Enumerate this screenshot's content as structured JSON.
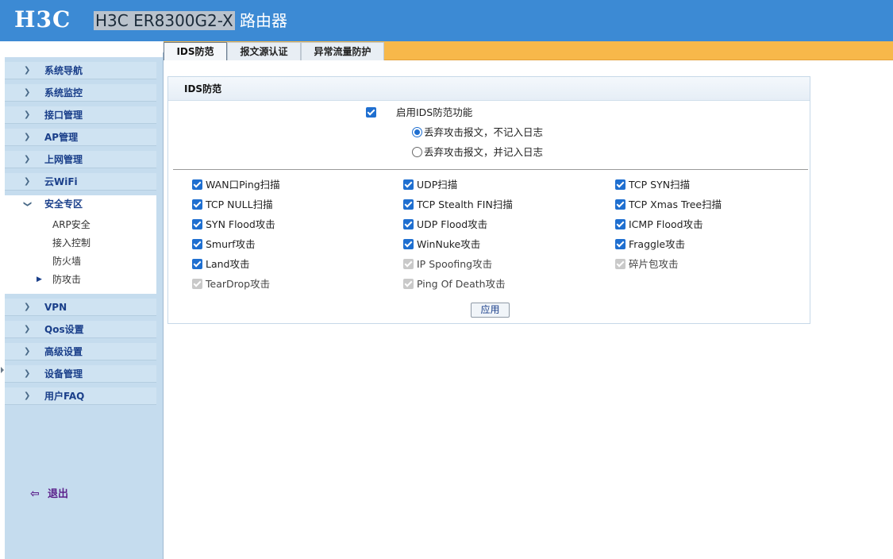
{
  "header": {
    "logo": "H3C",
    "model": "H3C ER8300G2-X",
    "product_suffix": " 路由器"
  },
  "tabs": [
    {
      "label": "IDS防范",
      "active": true
    },
    {
      "label": "报文源认证",
      "active": false
    },
    {
      "label": "异常流量防护",
      "active": false
    }
  ],
  "sidebar": {
    "items": [
      {
        "label": "系统导航"
      },
      {
        "label": "系统监控"
      },
      {
        "label": "接口管理"
      },
      {
        "label": "AP管理"
      },
      {
        "label": "上网管理"
      },
      {
        "label": "云WiFi"
      },
      {
        "label": "安全专区",
        "open": true,
        "children": [
          {
            "label": "ARP安全"
          },
          {
            "label": "接入控制"
          },
          {
            "label": "防火墙"
          },
          {
            "label": "防攻击",
            "current": true
          }
        ]
      },
      {
        "label": "VPN"
      },
      {
        "label": "Qos设置"
      },
      {
        "label": "高级设置"
      },
      {
        "label": "设备管理"
      },
      {
        "label": "用户FAQ"
      }
    ],
    "logout_label": "退出"
  },
  "panel": {
    "title": "IDS防范",
    "enable_label": "启用IDS防范功能",
    "radio_options": [
      {
        "label": "丢弃攻击报文，不记入日志",
        "selected": true
      },
      {
        "label": "丢弃攻击报文，并记入日志",
        "selected": false
      }
    ],
    "options": [
      {
        "label": "WAN口Ping扫描",
        "checked": true,
        "disabled": false
      },
      {
        "label": "UDP扫描",
        "checked": true,
        "disabled": false
      },
      {
        "label": "TCP SYN扫描",
        "checked": true,
        "disabled": false
      },
      {
        "label": "TCP NULL扫描",
        "checked": true,
        "disabled": false
      },
      {
        "label": "TCP Stealth FIN扫描",
        "checked": true,
        "disabled": false
      },
      {
        "label": "TCP Xmas Tree扫描",
        "checked": true,
        "disabled": false
      },
      {
        "label": "SYN Flood攻击",
        "checked": true,
        "disabled": false
      },
      {
        "label": "UDP Flood攻击",
        "checked": true,
        "disabled": false
      },
      {
        "label": "ICMP Flood攻击",
        "checked": true,
        "disabled": false
      },
      {
        "label": "Smurf攻击",
        "checked": true,
        "disabled": false
      },
      {
        "label": "WinNuke攻击",
        "checked": true,
        "disabled": false
      },
      {
        "label": "Fraggle攻击",
        "checked": true,
        "disabled": false
      },
      {
        "label": "Land攻击",
        "checked": true,
        "disabled": false
      },
      {
        "label": "IP Spoofing攻击",
        "checked": true,
        "disabled": true
      },
      {
        "label": "碎片包攻击",
        "checked": true,
        "disabled": true
      },
      {
        "label": "TearDrop攻击",
        "checked": true,
        "disabled": true
      },
      {
        "label": "Ping Of Death攻击",
        "checked": true,
        "disabled": true
      }
    ],
    "apply_label": "应用"
  },
  "colors": {
    "header_bg": "#3c8ad4",
    "tab_bar": "#f7b84a",
    "sidebar_bg": "#c5dcee",
    "menu_text": "#1a3f8a",
    "checkbox": "#1f6fd0"
  }
}
